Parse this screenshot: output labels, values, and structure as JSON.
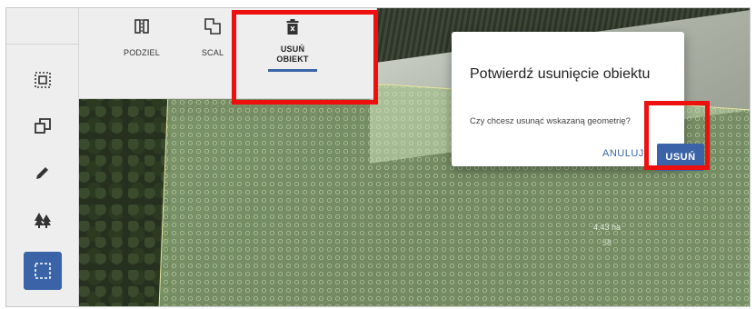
{
  "toolbar": {
    "tools": [
      {
        "label": "PODZIEL",
        "icon": "split-icon"
      },
      {
        "label": "SCAL",
        "icon": "merge-icon"
      },
      {
        "label": "USUŃ\nOBIEKT",
        "icon": "trash-icon",
        "active": true
      }
    ]
  },
  "sidebar": {
    "items": [
      {
        "icon": "select-area-icon"
      },
      {
        "icon": "copy-icon"
      },
      {
        "icon": "pencil-icon"
      },
      {
        "icon": "trees-icon"
      },
      {
        "icon": "selection-box-icon",
        "active": true
      }
    ]
  },
  "dialog": {
    "title": "Potwierdź usunięcie obiektu",
    "message": "Czy chcesz usunąć wskazaną geometrię?",
    "cancel_label": "ANULUJ",
    "confirm_label": "USUŃ"
  },
  "map": {
    "area_label": "4.43 ha",
    "area_sub": "58"
  },
  "colors": {
    "accent": "#3b64a8",
    "highlight": "#ee0f0f",
    "parcel_fill": "#9fbf86"
  }
}
